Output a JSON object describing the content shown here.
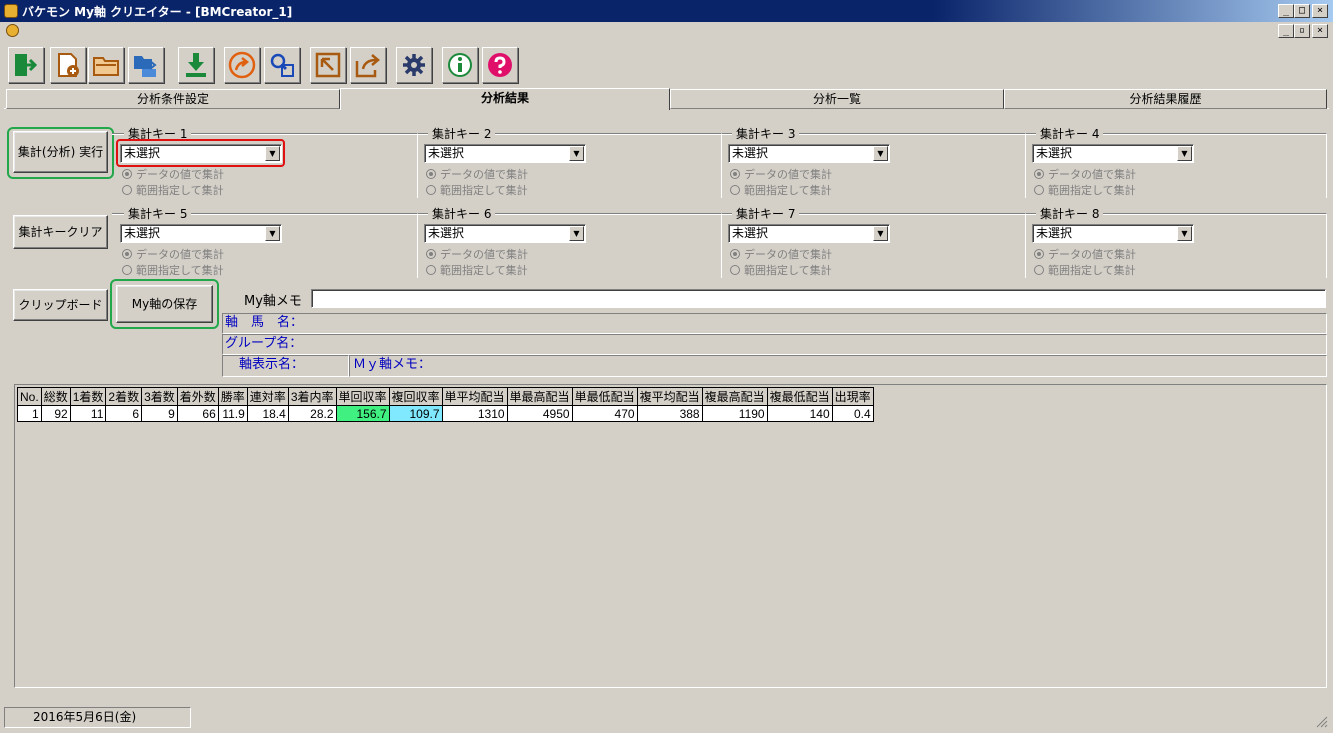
{
  "window": {
    "title": "バケモン My軸 クリエイター - [BMCreator_1]",
    "controls": [
      "_",
      "□",
      "×"
    ],
    "mdi_controls": [
      "_",
      "▫",
      "×"
    ]
  },
  "toolbar": {
    "buttons": [
      {
        "name": "exit-icon",
        "color": "#1a8a3a"
      },
      {
        "name": "new-file-icon",
        "color": "#a85a10"
      },
      {
        "name": "open-folder-icon",
        "color": "#a85a10"
      },
      {
        "name": "folder-transfer-icon",
        "color": "#2a6ab8"
      },
      {
        "name": "download-icon",
        "color": "#1a8a3a"
      },
      {
        "name": "forward-arrow-icon",
        "color": "#e06010"
      },
      {
        "name": "search-link-icon",
        "color": "#1a4ab8"
      },
      {
        "name": "export-icon",
        "color": "#a85a10"
      },
      {
        "name": "share-icon",
        "color": "#a85a10"
      },
      {
        "name": "gear-icon",
        "color": "#2a3a6a"
      },
      {
        "name": "info-icon",
        "color": "#1a8a3a"
      },
      {
        "name": "help-icon",
        "color": "#e0106a"
      }
    ]
  },
  "tabs": [
    {
      "label": "分析条件設定",
      "active": false
    },
    {
      "label": "分析結果",
      "active": true
    },
    {
      "label": "分析一覧",
      "active": false
    },
    {
      "label": "分析結果履歴",
      "active": false
    }
  ],
  "buttons": {
    "run": "集計(分析) 実行",
    "clear": "集計キークリア",
    "clipboard": "クリップボード",
    "save": "My軸の保存"
  },
  "keys": [
    {
      "label": "集計キー 1",
      "value": "未選択"
    },
    {
      "label": "集計キー 2",
      "value": "未選択"
    },
    {
      "label": "集計キー 3",
      "value": "未選択"
    },
    {
      "label": "集計キー 4",
      "value": "未選択"
    },
    {
      "label": "集計キー 5",
      "value": "未選択"
    },
    {
      "label": "集計キー 6",
      "value": "未選択"
    },
    {
      "label": "集計キー 7",
      "value": "未選択"
    },
    {
      "label": "集計キー 8",
      "value": "未選択"
    }
  ],
  "radio_options": [
    "データの値で集計",
    "範囲指定して集計"
  ],
  "memo": {
    "label": "My軸メモ",
    "value": ""
  },
  "info": {
    "axis_horse": "軸　馬　名：",
    "group": "グループ名：",
    "display": "軸表示名：",
    "memo": "Ｍｙ軸メモ："
  },
  "table": {
    "headers": [
      "No.",
      "総数",
      "1着数",
      "2着数",
      "3着数",
      "着外数",
      "勝率",
      "連対率",
      "3着内率",
      "単回収率",
      "複回収率",
      "単平均配当",
      "単最高配当",
      "単最低配当",
      "複平均配当",
      "複最高配当",
      "複最低配当",
      "出現率"
    ],
    "rows": [
      [
        "1",
        "92",
        "11",
        "6",
        "9",
        "66",
        "11.9",
        "18.4",
        "28.2",
        "156.7",
        "109.7",
        "1310",
        "4950",
        "470",
        "388",
        "1190",
        "140",
        "0.4"
      ]
    ],
    "highlight_colors": {
      "単回収率": "#40f080",
      "複回収率": "#80e8ff"
    }
  },
  "status": {
    "date": "2016年5月6日(金)"
  }
}
